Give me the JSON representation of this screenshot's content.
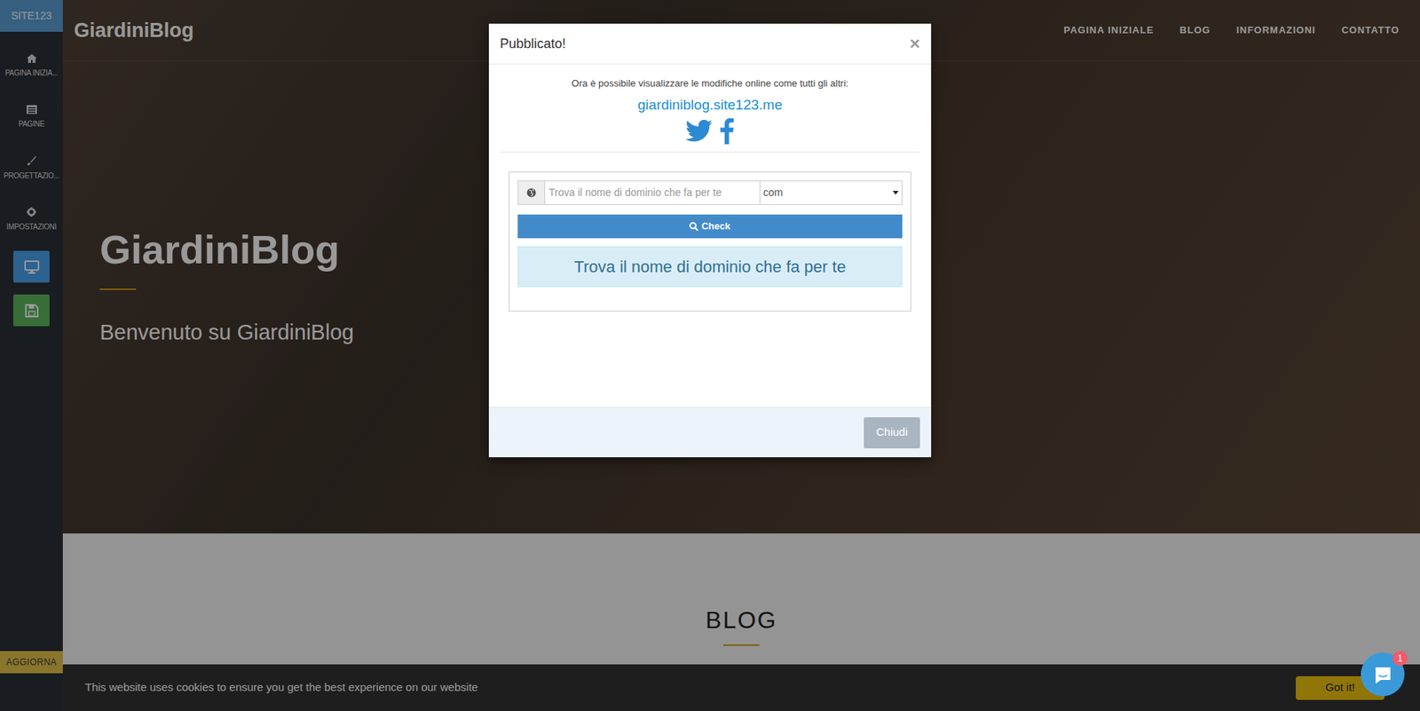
{
  "sidebar": {
    "brand": "SITE123",
    "items": [
      {
        "label": "PAGINA INIZIA..."
      },
      {
        "label": "PAGINE"
      },
      {
        "label": "PROGETTAZIO..."
      },
      {
        "label": "IMPOSTAZIONI"
      }
    ],
    "update": "AGGIORNA"
  },
  "site": {
    "logo": "GiardiniBlog",
    "nav": [
      {
        "label": "PAGINA INIZIALE"
      },
      {
        "label": "BLOG"
      },
      {
        "label": "INFORMAZIONI"
      },
      {
        "label": "CONTATTO"
      }
    ],
    "hero_title": "GiardiniBlog",
    "hero_subtitle": "Benvenuto su GiardiniBlog",
    "section_title": "BLOG"
  },
  "cookie_bar": {
    "text": "This website uses cookies to ensure you get the best experience on our website",
    "button": "Got it!"
  },
  "chat": {
    "badge": "1"
  },
  "modal": {
    "title": "Pubblicato!",
    "close": "×",
    "message": "Ora è possibile visualizzare le modifiche online come tutti gli altri:",
    "link": "giardiniblog.site123.me",
    "domain_search": {
      "placeholder": "Trova il nome di dominio che fa per te",
      "tld": "com",
      "button": "Check",
      "info": "Trova il nome di dominio che fa per te"
    },
    "footer_button": "Chiudi"
  }
}
